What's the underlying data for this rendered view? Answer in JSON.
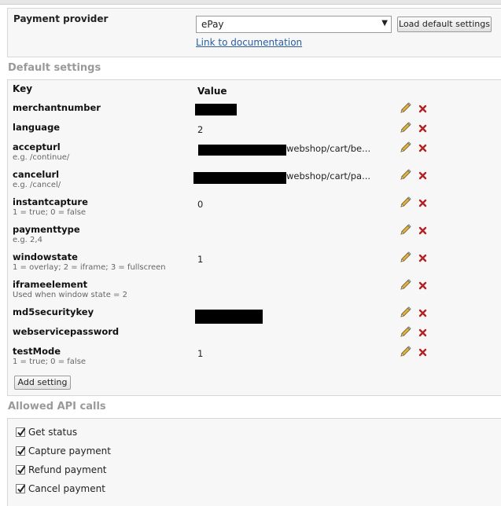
{
  "provider": {
    "label": "Payment provider",
    "selected": "ePay",
    "load_button": "Load default settings",
    "doc_link": "Link to documentation"
  },
  "default_settings": {
    "title": "Default settings",
    "columns": {
      "key": "Key",
      "value": "Value"
    },
    "rows": [
      {
        "key": "merchantnumber",
        "hint": "",
        "value": ""
      },
      {
        "key": "language",
        "hint": "",
        "value": "2"
      },
      {
        "key": "accepturl",
        "hint": "e.g. /continue/",
        "value": "webshop/cart/be..."
      },
      {
        "key": "cancelurl",
        "hint": "e.g. /cancel/",
        "value": "webshop/cart/pa..."
      },
      {
        "key": "instantcapture",
        "hint": "1 = true; 0 = false",
        "value": "0"
      },
      {
        "key": "paymenttype",
        "hint": "e.g. 2,4",
        "value": ""
      },
      {
        "key": "windowstate",
        "hint": "1 = overlay; 2 = iframe; 3 = fullscreen",
        "value": "1"
      },
      {
        "key": "iframeelement",
        "hint": "Used when window state = 2",
        "value": ""
      },
      {
        "key": "md5securitykey",
        "hint": "",
        "value": ""
      },
      {
        "key": "webservicepassword",
        "hint": "",
        "value": ""
      },
      {
        "key": "testMode",
        "hint": "1 = true; 0 = false",
        "value": "1"
      }
    ],
    "add_button": "Add setting"
  },
  "api_calls": {
    "title": "Allowed API calls",
    "items": [
      {
        "label": "Get status",
        "checked": true
      },
      {
        "label": "Capture payment",
        "checked": true
      },
      {
        "label": "Refund payment",
        "checked": true
      },
      {
        "label": "Cancel payment",
        "checked": true
      }
    ]
  },
  "icons": {
    "edit": "pencil-icon",
    "delete": "delete-x-icon"
  },
  "colors": {
    "link": "#2a5d9f",
    "delete": "#b22222",
    "section_title": "#9a9a9a"
  }
}
